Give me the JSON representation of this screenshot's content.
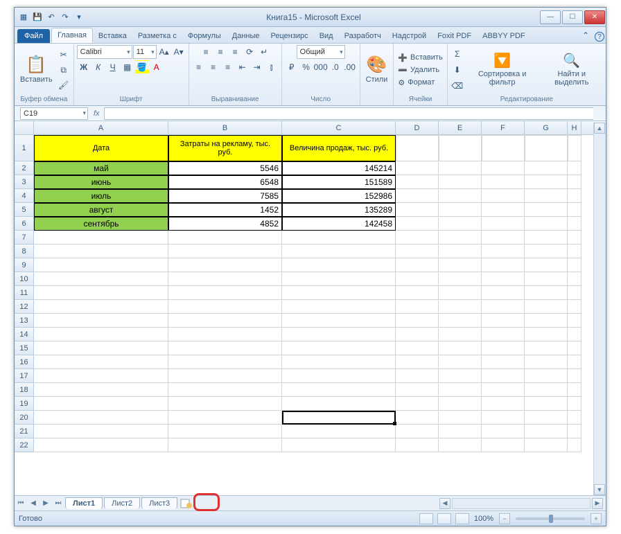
{
  "title": "Книга15 - Microsoft Excel",
  "tabs": {
    "file": "Файл",
    "home": "Главная",
    "insert": "Вставка",
    "layout": "Разметка с",
    "formulas": "Формулы",
    "data": "Данные",
    "review": "Рецензирс",
    "view": "Вид",
    "dev": "Разработч",
    "addins": "Надстрой",
    "foxit": "Foxit PDF",
    "abbyy": "ABBYY PDF"
  },
  "ribbon": {
    "paste": "Вставить",
    "clipboard": "Буфер обмена",
    "fontname": "Calibri",
    "fontsize": "11",
    "font": "Шрифт",
    "align": "Выравнивание",
    "numfmt": "Общий",
    "number": "Число",
    "styles": "Стили",
    "insert": "Вставить",
    "delete": "Удалить",
    "format": "Формат",
    "cells": "Ячейки",
    "sort": "Сортировка и фильтр",
    "find": "Найти и выделить",
    "editing": "Редактирование"
  },
  "namebox": "C19",
  "cols": [
    "A",
    "B",
    "C",
    "D",
    "E",
    "F",
    "G",
    "H"
  ],
  "headers": {
    "A": "Дата",
    "B": "Затраты на рекламу, тыс. руб.",
    "C": "Величина продаж, тыс. руб."
  },
  "rows": [
    {
      "n": "2",
      "A": "май",
      "B": "5546",
      "C": "145214"
    },
    {
      "n": "3",
      "A": "июнь",
      "B": "6548",
      "C": "151589"
    },
    {
      "n": "4",
      "A": "июль",
      "B": "7585",
      "C": "152986"
    },
    {
      "n": "5",
      "A": "август",
      "B": "1452",
      "C": "135289"
    },
    {
      "n": "6",
      "A": "сентябрь",
      "B": "4852",
      "C": "142458"
    }
  ],
  "sheets": {
    "s1": "Лист1",
    "s2": "Лист2",
    "s3": "Лист3"
  },
  "status": {
    "ready": "Готово",
    "zoom": "100%"
  }
}
